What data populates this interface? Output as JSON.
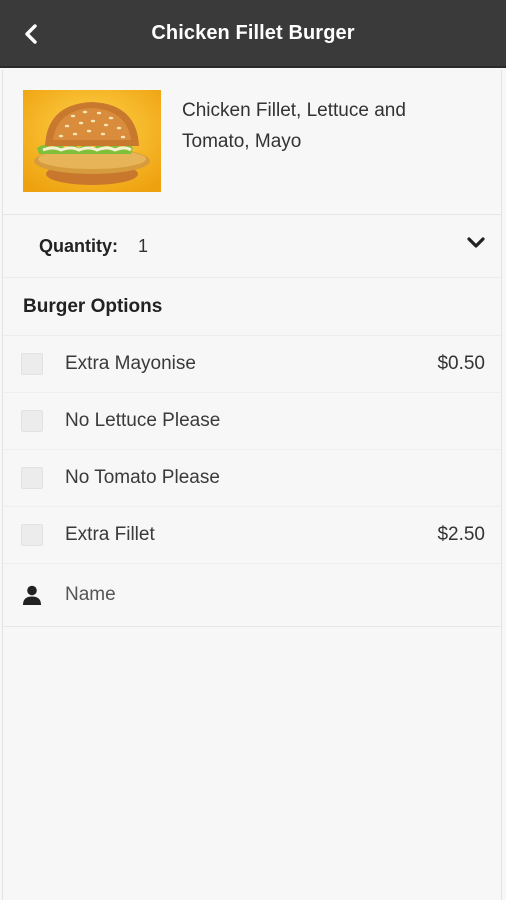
{
  "header": {
    "title": "Chicken Fillet Burger",
    "back_icon": "chevron-left-icon"
  },
  "product": {
    "image_icon": "burger-image",
    "description": "Chicken Fillet, Lettuce and Tomato, Mayo"
  },
  "quantity": {
    "label": "Quantity:",
    "value": "1",
    "dropdown_icon": "chevron-down-icon"
  },
  "options_section": {
    "title": "Burger Options",
    "items": [
      {
        "label": "Extra Mayonise",
        "price": "$0.50",
        "checked": false
      },
      {
        "label": "No Lettuce Please",
        "price": "",
        "checked": false
      },
      {
        "label": "No Tomato Please",
        "price": "",
        "checked": false
      },
      {
        "label": "Extra Fillet",
        "price": "$2.50",
        "checked": false
      }
    ]
  },
  "name_field": {
    "icon": "user-icon",
    "placeholder": "Name",
    "value": ""
  },
  "colors": {
    "header_bg": "#3a3a3a",
    "page_bg": "#f7f7f7",
    "image_bg": "#f2b21a"
  }
}
